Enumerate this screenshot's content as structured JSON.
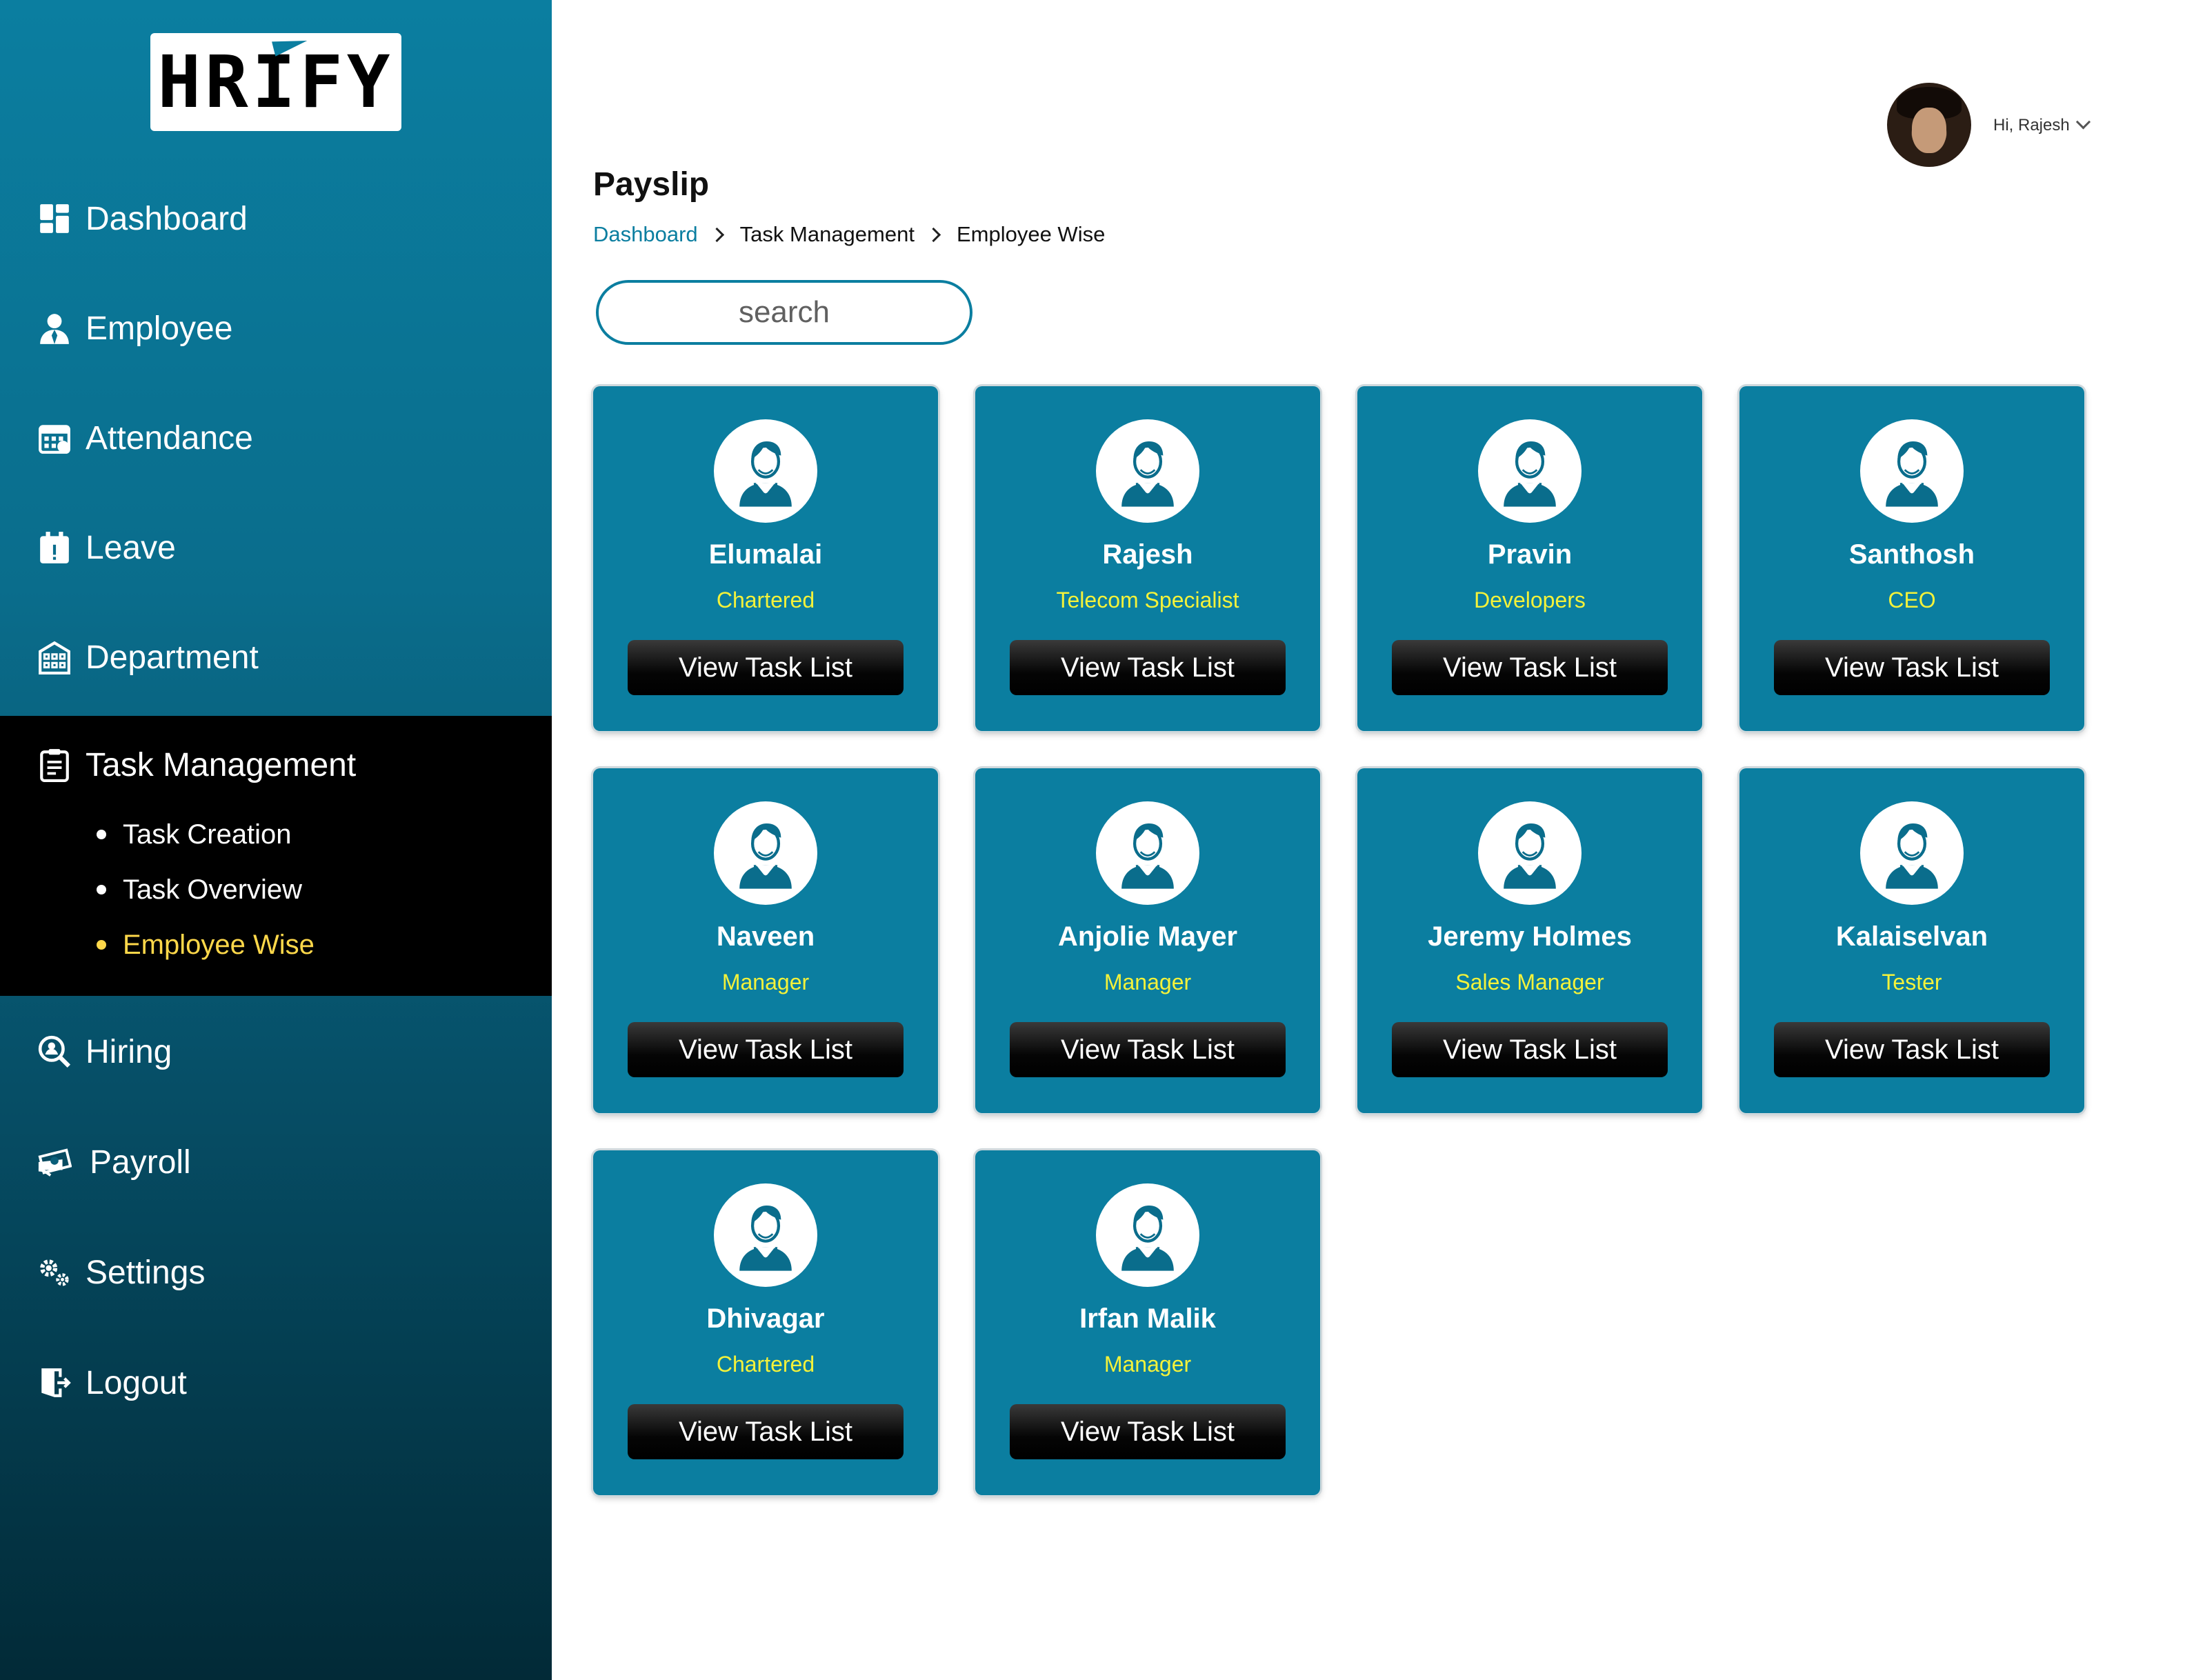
{
  "app": {
    "logo_text": "HRIFY"
  },
  "sidebar": {
    "items": [
      {
        "label": "Dashboard",
        "icon": "dashboard-icon"
      },
      {
        "label": "Employee",
        "icon": "employee-icon"
      },
      {
        "label": "Attendance",
        "icon": "calendar-icon"
      },
      {
        "label": "Leave",
        "icon": "leave-calendar-icon"
      },
      {
        "label": "Department",
        "icon": "building-icon"
      },
      {
        "label": "Task Management",
        "icon": "clipboard-icon",
        "active": true
      },
      {
        "label": "Hiring",
        "icon": "hiring-search-icon"
      },
      {
        "label": "Payroll",
        "icon": "money-icon"
      },
      {
        "label": "Settings",
        "icon": "gears-icon"
      },
      {
        "label": "Logout",
        "icon": "logout-door-icon"
      }
    ],
    "sub_items": [
      {
        "label": "Task Creation"
      },
      {
        "label": "Task Overview"
      },
      {
        "label": "Employee Wise",
        "selected": true
      }
    ],
    "colors": {
      "active_bg": "#000000",
      "selected_sub": "#ffd84a",
      "gradient_top": "#0b7ea0",
      "gradient_bottom": "#022a37"
    }
  },
  "header": {
    "greeting": "Hi, Rajesh"
  },
  "main": {
    "title": "Payslip",
    "breadcrumb": [
      "Dashboard",
      "Task Management",
      "Employee Wise"
    ],
    "search_placeholder": "search",
    "employees": [
      {
        "name": "Elumalai",
        "role": "Chartered",
        "button": "View Task List"
      },
      {
        "name": "Rajesh",
        "role": "Telecom Specialist",
        "button": "View Task List"
      },
      {
        "name": "Pravin",
        "role": "Developers",
        "button": "View Task List"
      },
      {
        "name": "Santhosh",
        "role": "CEO",
        "button": "View Task List"
      },
      {
        "name": "Naveen",
        "role": "Manager",
        "button": "View Task List"
      },
      {
        "name": "Anjolie Mayer",
        "role": "Manager",
        "button": "View Task List"
      },
      {
        "name": "Jeremy Holmes",
        "role": "Sales Manager",
        "button": "View Task List"
      },
      {
        "name": "Kalaiselvan",
        "role": "Tester",
        "button": "View Task List"
      },
      {
        "name": "Dhivagar",
        "role": "Chartered",
        "button": "View Task List"
      },
      {
        "name": "Irfan Malik",
        "role": "Manager",
        "button": "View Task List"
      }
    ],
    "colors": {
      "card_bg": "#0b7ea0",
      "role_text": "#f4f23a",
      "button_bg": "#000000",
      "link": "#0b7ea0"
    }
  }
}
